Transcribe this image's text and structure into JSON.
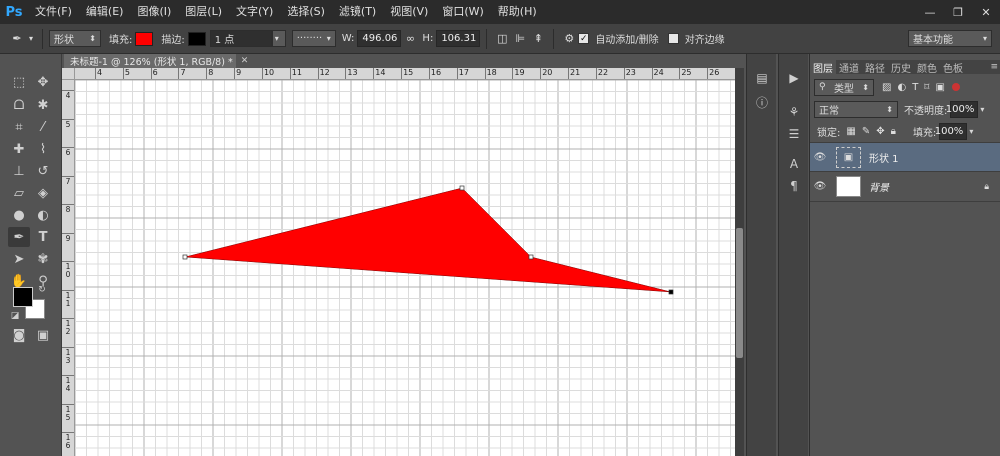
{
  "app": {
    "logo": "Ps"
  },
  "menu": [
    "文件(F)",
    "编辑(E)",
    "图像(I)",
    "图层(L)",
    "文字(Y)",
    "选择(S)",
    "滤镜(T)",
    "视图(V)",
    "窗口(W)",
    "帮助(H)"
  ],
  "window_controls": {
    "minimize": "—",
    "restore": "❐",
    "close": "✕"
  },
  "options": {
    "tool_mode": "形状",
    "fill_label": "填充:",
    "fill_color": "#ff0000",
    "stroke_label": "描边:",
    "stroke_color": "#000000",
    "stroke_width": "1 点",
    "stroke_style": "········",
    "w_label": "W:",
    "w_value": "496.06",
    "h_label": "H:",
    "h_value": "106.31",
    "auto_add_delete": "自动添加/删除",
    "align_edges": "对齐边缘",
    "workspace": "基本功能"
  },
  "document": {
    "tab_title": "未标题-1 @ 126% (形状 1, RGB/8) *"
  },
  "ruler": {
    "top_labels": [
      "4",
      "5",
      "6",
      "7",
      "8",
      "9",
      "10",
      "11",
      "12",
      "13",
      "14",
      "15",
      "16",
      "17",
      "18",
      "19",
      "20",
      "21",
      "22",
      "23",
      "24",
      "25",
      "26"
    ],
    "left_labels": [
      "4",
      "5",
      "6",
      "7",
      "8",
      "9",
      "10",
      "11",
      "12",
      "13",
      "14",
      "15",
      "16"
    ]
  },
  "colors": {
    "shape_fill": "#ff0000",
    "foreground": "#000000",
    "background": "#ffffff",
    "selection": "#5a6b80"
  },
  "layers_panel": {
    "tabs": [
      "图层",
      "通道",
      "路径",
      "历史",
      "颜色",
      "色板"
    ],
    "filter": "类型",
    "blend_mode": "正常",
    "opacity_label": "不透明度:",
    "opacity": "100%",
    "lock_label": "锁定:",
    "fill_label": "填充:",
    "fill": "100%",
    "layers": [
      {
        "name": "形状 1",
        "selected": true
      },
      {
        "name": "背景",
        "selected": false,
        "locked": true
      }
    ]
  }
}
